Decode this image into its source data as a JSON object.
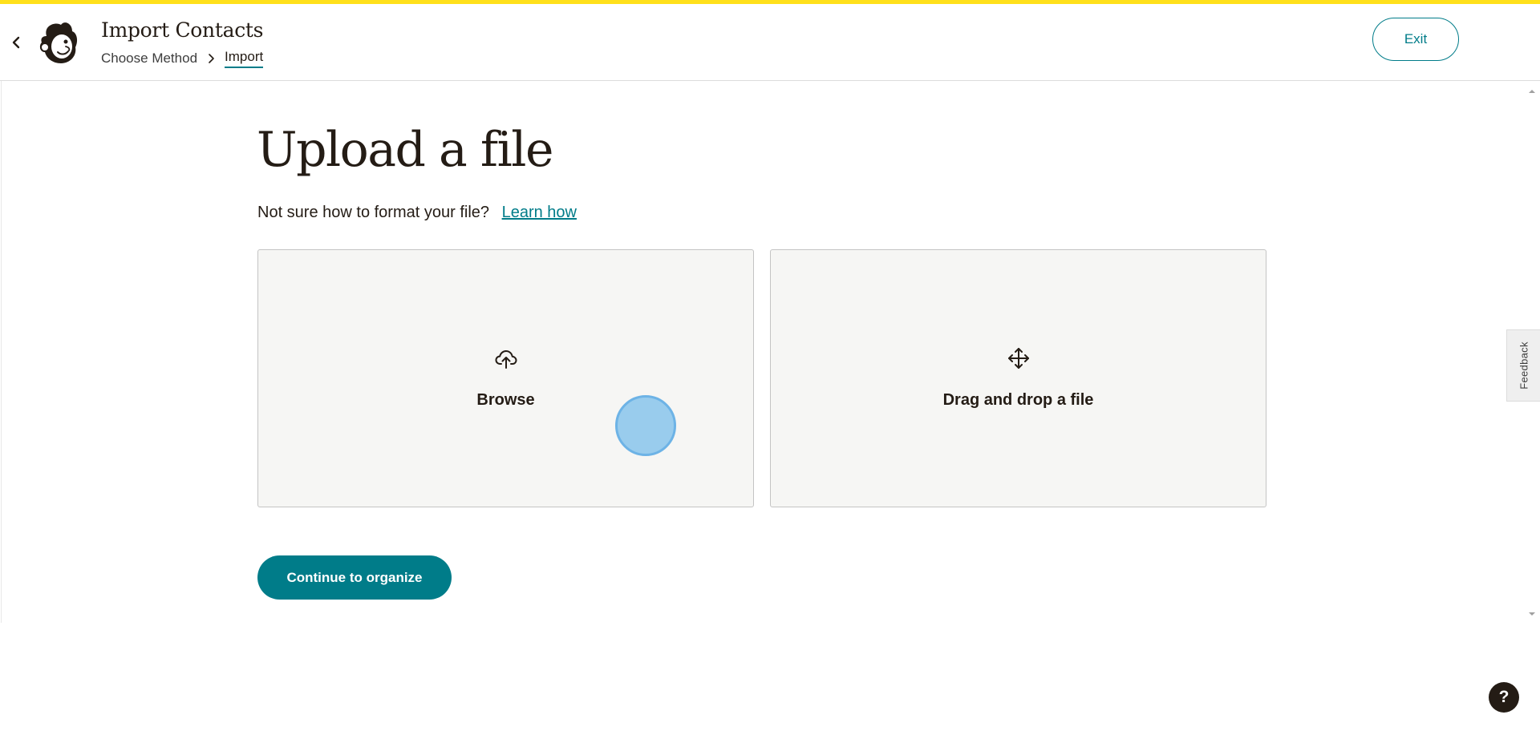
{
  "header": {
    "title": "Import Contacts",
    "breadcrumb": [
      {
        "label": "Choose Method"
      },
      {
        "label": "Import"
      }
    ],
    "exit_label": "Exit"
  },
  "main": {
    "page_title": "Upload a file",
    "help_text": "Not sure how to format your file?",
    "learn_link": "Learn how",
    "options": [
      {
        "label": "Browse",
        "icon": "cloud-upload-icon"
      },
      {
        "label": "Drag and drop a file",
        "icon": "move-arrows-icon"
      }
    ],
    "continue_label": "Continue to organize"
  },
  "sidebar_tabs": {
    "feedback_label": "Feedback"
  },
  "help_button_label": "?",
  "colors": {
    "accent_yellow": "#ffe01b",
    "brand_teal": "#007c89",
    "text_dark": "#241c15",
    "card_bg": "#f6f6f4"
  }
}
